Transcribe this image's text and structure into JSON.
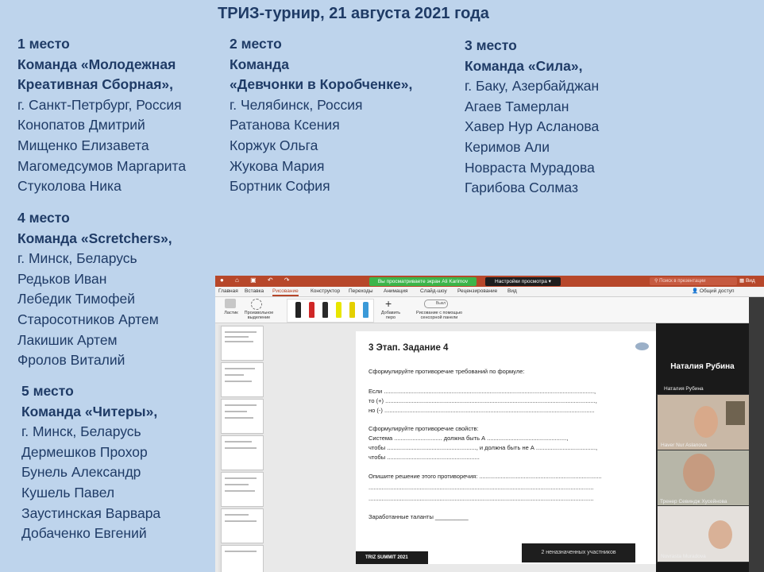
{
  "title": "ТРИЗ-турнир, 21 августа 2021 года",
  "teams": [
    {
      "place": "1 место",
      "name_lines": [
        "Команда «Молодежная",
        "Креативная Сборная»,"
      ],
      "city": "г. Санкт-Петрбург, Россия",
      "members": [
        "Конопатов Дмитрий",
        "Мищенко Елизавета",
        "Магомедсумов Маргарита",
        "Стуколова Ника"
      ]
    },
    {
      "place": "2 место",
      "name_lines": [
        "Команда",
        "«Девчонки в Коробченке»,"
      ],
      "city": "г. Челябинск, Россия",
      "members": [
        "Ратанова Ксения",
        "Коржук Ольга",
        "Жукова Мария",
        "Бортник София"
      ]
    },
    {
      "place": "3 место",
      "name_lines": [
        "Команда «Сила»,"
      ],
      "city": "г. Баку, Азербайджан",
      "members": [
        "Агаев Тамерлан",
        "Хавер Нур Асланова",
        "Керимов Али",
        "Новраста Мурадова",
        "Гарибова Солмаз"
      ]
    },
    {
      "place": "4 место",
      "name_lines": [
        "Команда «Scretchers»,"
      ],
      "city": "г. Минск, Беларусь",
      "members": [
        "Редьков Иван",
        "Лебедик Тимофей",
        "Старосотников Артем",
        "Лакишик Артем",
        "Фролов Виталий"
      ]
    },
    {
      "place": "5 место",
      "name_lines": [
        "Команда «Читеры»,"
      ],
      "city": "г. Минск, Беларусь",
      "members": [
        "Дермешков Прохор",
        "Бунель Александр",
        "Кушель Павел",
        "Заустинская Варвара",
        "Добаченко Евгений"
      ]
    }
  ],
  "screenshot": {
    "titlebar": {
      "share_notice": "Вы просматриваете экран Ali Karimov",
      "view_settings": "Настройки просмотра",
      "search_placeholder": "Поиск в презентации",
      "right_label": "Вид"
    },
    "tabs": [
      "Главная",
      "Вставка",
      "Рисование",
      "Конструктор",
      "Переходы",
      "Анимация",
      "Слайд-шоу",
      "Рецензирование",
      "Вид"
    ],
    "active_tab": "Рисование",
    "share_button": "Общий доступ",
    "ribbon": {
      "eraser": "Ластик",
      "lasso": "Произвольное выделение",
      "add_pen": "Добавить перо",
      "draw_touch": "Рисование с помощью сенсорной панели",
      "toggle": "Выкл"
    },
    "pen_colors": [
      "#222222",
      "#d02828",
      "#2a2a2a",
      "#e8e600",
      "#e4d000",
      "#3b9ad8"
    ],
    "slide": {
      "title": "3 Этап. Задание 4",
      "lines": [
        "Сформулируйте противоречие требований по формуле:",
        "Если   ...............................................................................................................................,",
        "то (+) ...............................................................................................................................,",
        "но (-) ...............................................................................................................................",
        "Сформулируйте противоречие свойств:",
        "Система   .............................  должна  быть  А  ................................................,",
        "чтобы ......................................................, и должна быть не А ....................................,",
        "чтобы ........................................................",
        "Опишите решение этого противоречия: ..........................................................................",
        "........................................................................................................................................",
        "........................................................................................................................................",
        "Заработанные таланты __________"
      ],
      "footer": "TRIZ SUMMIT 2021"
    },
    "unassigned": "2 неназначенных участников",
    "gallery": {
      "speaker": "Наталия Рубина",
      "participants": [
        "Наталия Рубина",
        "Haver Nur Aslanova",
        "Тренер Севиндж Хусейнова",
        "Novrasta Muradova"
      ]
    }
  }
}
